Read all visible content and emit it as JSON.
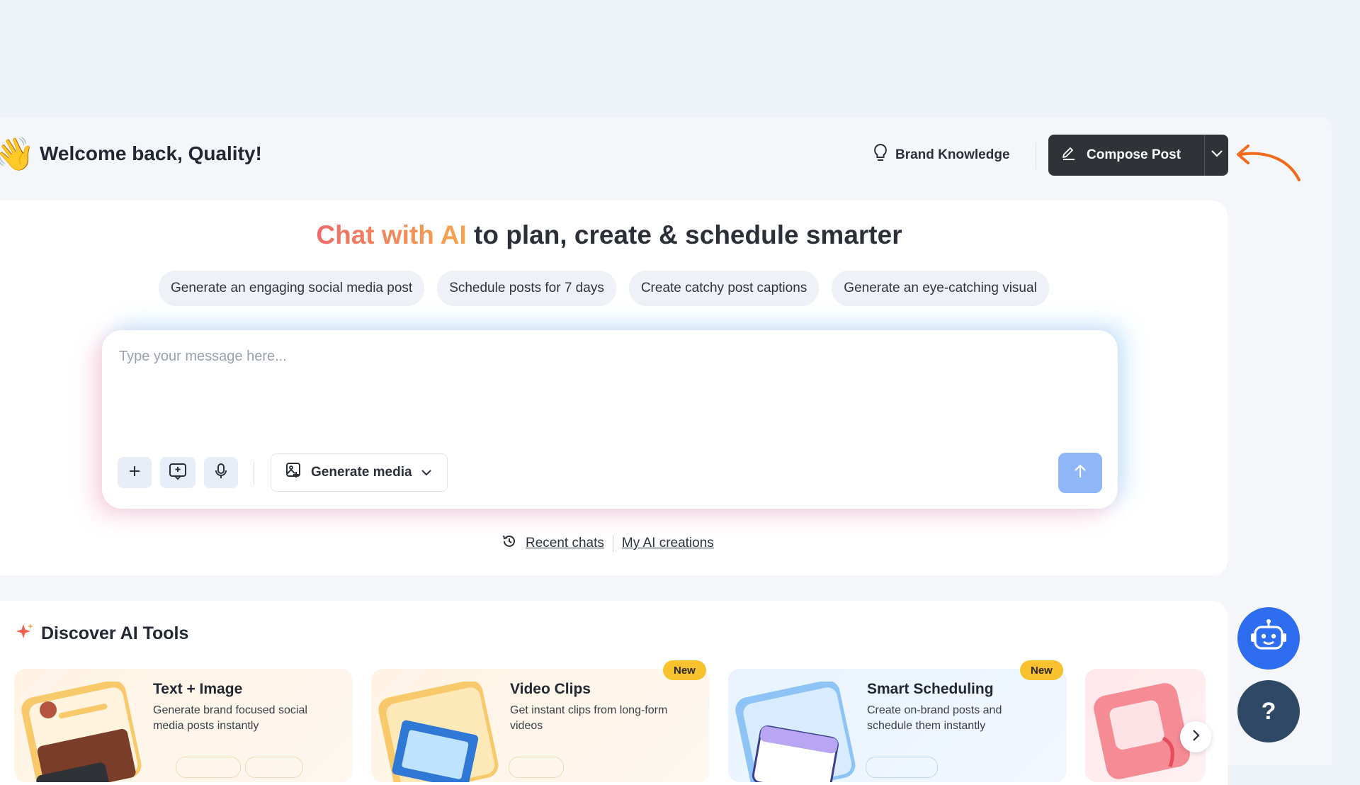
{
  "header": {
    "welcome": "Welcome back, Quality!",
    "brand_knowledge": "Brand Knowledge",
    "compose_post": "Compose Post"
  },
  "chat": {
    "headline_highlight": "Chat with AI",
    "headline_rest": " to plan, create & schedule smarter",
    "suggestions": [
      "Generate an engaging social media post",
      "Schedule posts for 7 days",
      "Create catchy post captions",
      "Generate an eye-catching visual"
    ],
    "placeholder": "Type your message here...",
    "generate_media": "Generate media",
    "recent_chats": "Recent chats",
    "my_ai_creations": "My AI creations"
  },
  "discover": {
    "title": "Discover AI Tools",
    "tools": [
      {
        "title": "Text + Image",
        "desc": "Generate brand focused social media posts instantly",
        "badge": ""
      },
      {
        "title": "Video Clips",
        "desc": "Get instant clips from long-form videos",
        "badge": "New"
      },
      {
        "title": "Smart Scheduling",
        "desc": "Create on-brand posts and schedule them instantly",
        "badge": "New"
      }
    ]
  },
  "fab": {
    "help": "?"
  },
  "colors": {
    "accent_blue": "#2f6df0",
    "compose_bg": "#2f3338",
    "badge_yellow": "#f8c22e",
    "annotation_arrow": "#f26a1b"
  }
}
